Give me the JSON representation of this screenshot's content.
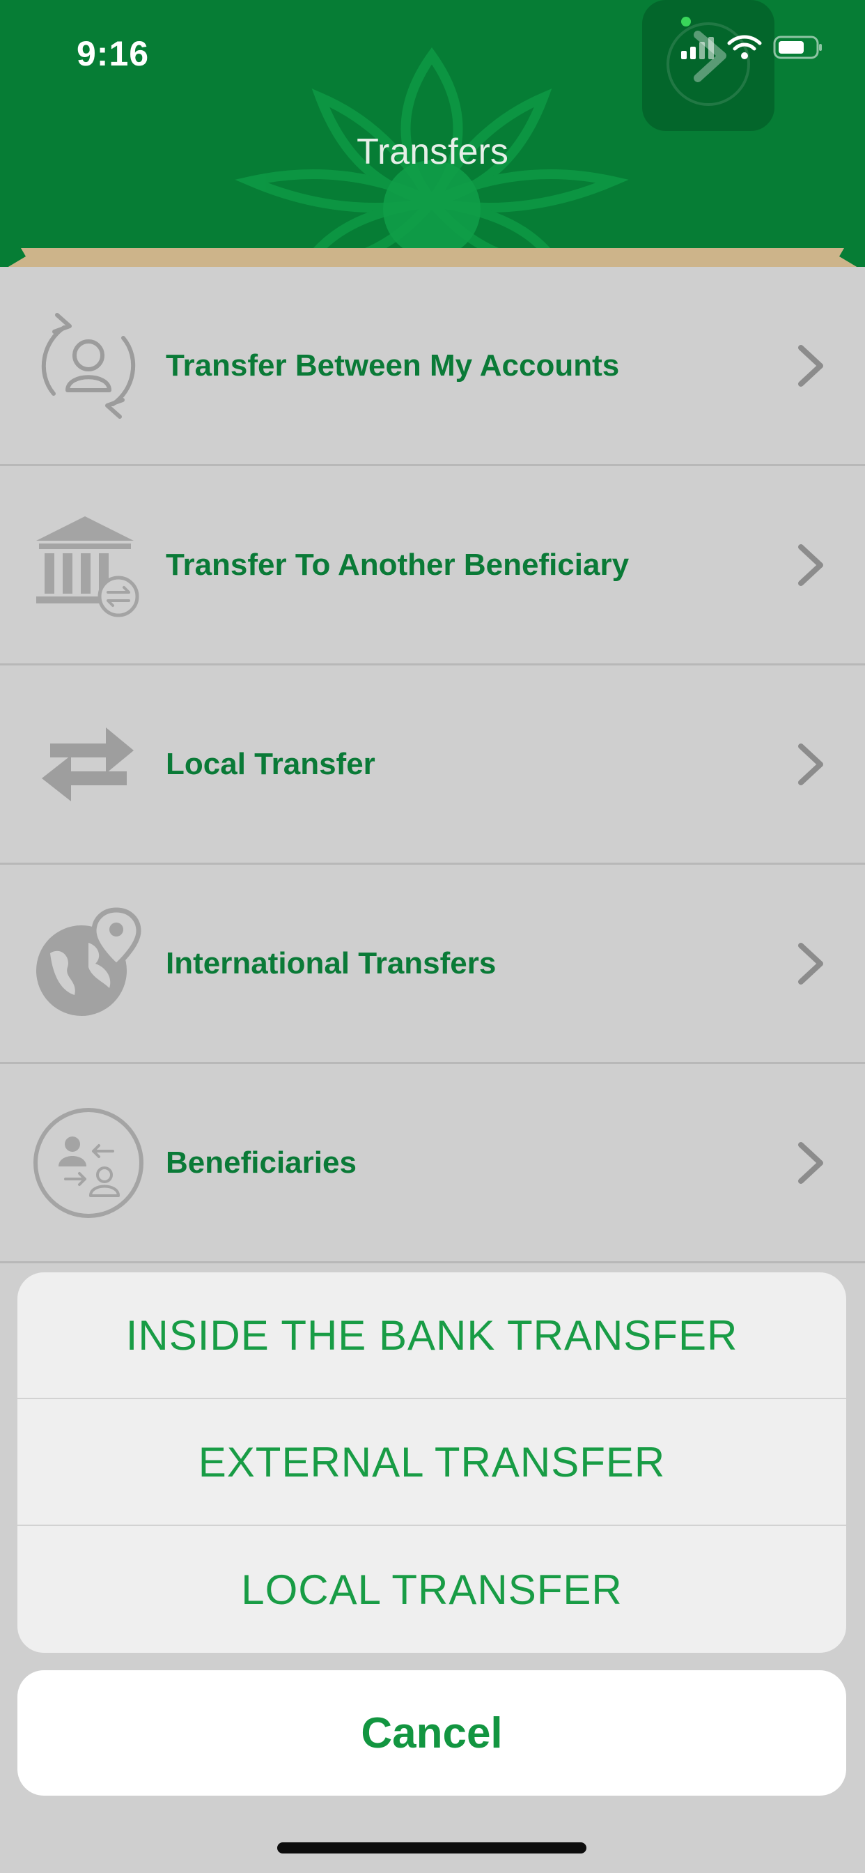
{
  "status_bar": {
    "time": "9:16"
  },
  "header": {
    "title": "Transfers"
  },
  "menu": {
    "items": [
      {
        "label": "Transfer Between My Accounts",
        "icon": "account-sync-icon"
      },
      {
        "label": "Transfer To Another Beneficiary",
        "icon": "bank-transfer-icon"
      },
      {
        "label": "Local Transfer",
        "icon": "swap-arrows-icon"
      },
      {
        "label": "International Transfers",
        "icon": "globe-pin-icon"
      },
      {
        "label": "Beneficiaries",
        "icon": "beneficiaries-icon"
      }
    ]
  },
  "action_sheet": {
    "options": [
      "INSIDE THE BANK TRANSFER",
      "EXTERNAL TRANSFER",
      "LOCAL TRANSFER"
    ],
    "cancel_label": "Cancel"
  },
  "colors": {
    "brand_green": "#067d35",
    "label_green": "#0a7a37",
    "action_green": "#189c45",
    "dim_overlay": "#cfcfcf"
  }
}
